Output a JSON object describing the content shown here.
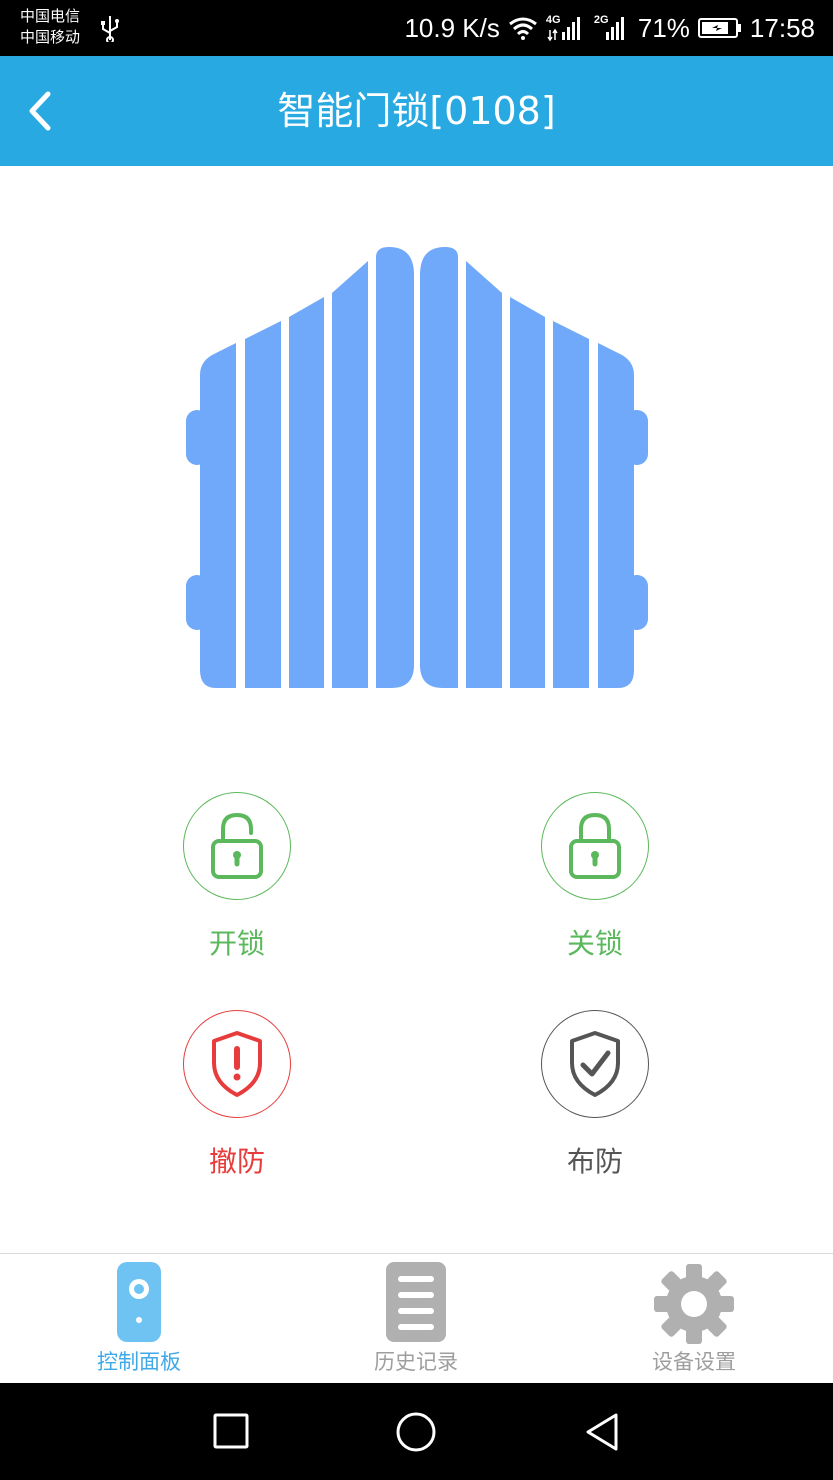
{
  "status_bar": {
    "carrier_1": "中国电信",
    "carrier_2": "中国移动",
    "net_speed": "10.9 K/s",
    "signal_1_tag": "4G",
    "signal_2_tag": "2G",
    "battery": "71%",
    "time": "17:58",
    "icons": [
      "usb-icon",
      "wifi-icon",
      "signal-icon",
      "battery-icon"
    ]
  },
  "header": {
    "title": "智能门锁[0108]",
    "back_icon": "chevron-left-icon",
    "color": "#29a9e1"
  },
  "hero": {
    "icon": "smart-lock-house-icon",
    "color": "#70a8fa"
  },
  "controls": [
    {
      "label": "开锁",
      "icon": "unlocked-padlock-icon",
      "color": "#5cb85c"
    },
    {
      "label": "关锁",
      "icon": "locked-padlock-icon",
      "color": "#5cb85c"
    },
    {
      "label": "撤防",
      "icon": "shield-alert-icon",
      "color": "#e83c3c"
    },
    {
      "label": "布防",
      "icon": "shield-check-icon",
      "color": "#555555"
    }
  ],
  "tabs": [
    {
      "label": "控制面板",
      "icon": "remote-control-icon",
      "active": true,
      "color": "#3fa9e8"
    },
    {
      "label": "历史记录",
      "icon": "document-list-icon",
      "active": false,
      "color": "#9e9e9e"
    },
    {
      "label": "设备设置",
      "icon": "gear-icon",
      "active": false,
      "color": "#9e9e9e"
    }
  ],
  "nav": {
    "icons": [
      "square-recents-icon",
      "circle-home-icon",
      "triangle-back-icon"
    ]
  }
}
